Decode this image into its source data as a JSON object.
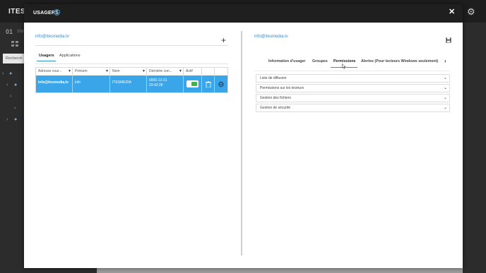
{
  "background": {
    "brand": "ITES",
    "left_number": "01",
    "left_label": "sta",
    "search_placeholder": "Recherch"
  },
  "modal": {
    "title": "USAGERS",
    "help_glyph": "?",
    "close_glyph": "✕"
  },
  "left_panel": {
    "email": "info@itesmedia.tv",
    "add_glyph": "+",
    "tabs": [
      {
        "label": "Usagers",
        "active": true
      },
      {
        "label": "Applications",
        "active": false
      }
    ],
    "grid": {
      "columns": [
        "Adresse cour...",
        "Prénom",
        "Nom",
        "Dernière con...",
        "Actif"
      ],
      "rows": [
        {
          "email": "info@itesmedia.tv",
          "first_name": "info",
          "last_name": "ITESMEDIA",
          "last_login_date": "0000-12-31",
          "last_login_time": "23:42:28",
          "active": true
        }
      ]
    }
  },
  "right_panel": {
    "email": "info@itesmedia.tv",
    "tabs": [
      {
        "label": "Information d'usager",
        "active": false
      },
      {
        "label": "Groupes",
        "active": false
      },
      {
        "label": "Permissions",
        "active": true
      },
      {
        "label": "Alertes (Pour lecteurs Windows seulement)",
        "active": false
      }
    ],
    "next_glyph": "›",
    "sections": [
      {
        "label": "Liste de diffusion"
      },
      {
        "label": "Permissions sur les lecteurs"
      },
      {
        "label": "Gestion des fichiers"
      },
      {
        "label": "Gestion de sécurité"
      }
    ]
  },
  "colors": {
    "accent": "#2e8fd1",
    "row_selected": "#3aa5e8",
    "toggle_on": "#3cb44a",
    "header_dark": "#1f1f1f"
  }
}
